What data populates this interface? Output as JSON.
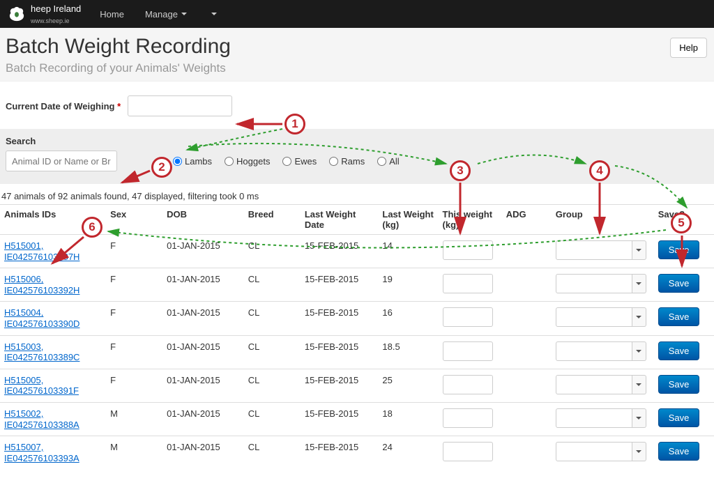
{
  "brand": {
    "name": "heep Ireland",
    "sub": "www.sheep.ie"
  },
  "nav": {
    "home": "Home",
    "manage": "Manage"
  },
  "page": {
    "title": "Batch Weight Recording",
    "subtitle": "Batch Recording of your Animals' Weights",
    "help": "Help"
  },
  "form": {
    "date_label": "Current Date of Weighing",
    "search_label": "Search",
    "search_placeholder": "Animal ID or Name or Br"
  },
  "filters": {
    "lambs": "Lambs",
    "hoggets": "Hoggets",
    "ewes": "Ewes",
    "rams": "Rams",
    "all": "All"
  },
  "results_count": "47 animals of 92 animals found, 47 displayed, filtering took 0 ms",
  "columns": {
    "ids": "Animals IDs",
    "sex": "Sex",
    "dob": "DOB",
    "breed": "Breed",
    "lwd": "Last Weight Date",
    "lwkg": "Last Weight (kg)",
    "twkg": "This weight (kg)",
    "adg": "ADG",
    "group": "Group",
    "save": "Save?"
  },
  "save_label": "Save",
  "rows": [
    {
      "id1": "H515001,",
      "id2": "IE042576103387H",
      "sex": "F",
      "dob": "01-JAN-2015",
      "breed": "CL",
      "lwd": "15-FEB-2015",
      "lw": "14"
    },
    {
      "id1": "H515006,",
      "id2": "IE042576103392H",
      "sex": "F",
      "dob": "01-JAN-2015",
      "breed": "CL",
      "lwd": "15-FEB-2015",
      "lw": "19"
    },
    {
      "id1": "H515004,",
      "id2": "IE042576103390D",
      "sex": "F",
      "dob": "01-JAN-2015",
      "breed": "CL",
      "lwd": "15-FEB-2015",
      "lw": "16"
    },
    {
      "id1": "H515003,",
      "id2": "IE042576103389C",
      "sex": "F",
      "dob": "01-JAN-2015",
      "breed": "CL",
      "lwd": "15-FEB-2015",
      "lw": "18.5"
    },
    {
      "id1": "H515005,",
      "id2": "IE042576103391F",
      "sex": "F",
      "dob": "01-JAN-2015",
      "breed": "CL",
      "lwd": "15-FEB-2015",
      "lw": "25"
    },
    {
      "id1": "H515002,",
      "id2": "IE042576103388A",
      "sex": "M",
      "dob": "01-JAN-2015",
      "breed": "CL",
      "lwd": "15-FEB-2015",
      "lw": "18"
    },
    {
      "id1": "H515007,",
      "id2": "IE042576103393A",
      "sex": "M",
      "dob": "01-JAN-2015",
      "breed": "CL",
      "lwd": "15-FEB-2015",
      "lw": "24"
    }
  ],
  "annotations": {
    "n1": "1",
    "n2": "2",
    "n3": "3",
    "n4": "4",
    "n5": "5",
    "n6": "6"
  }
}
